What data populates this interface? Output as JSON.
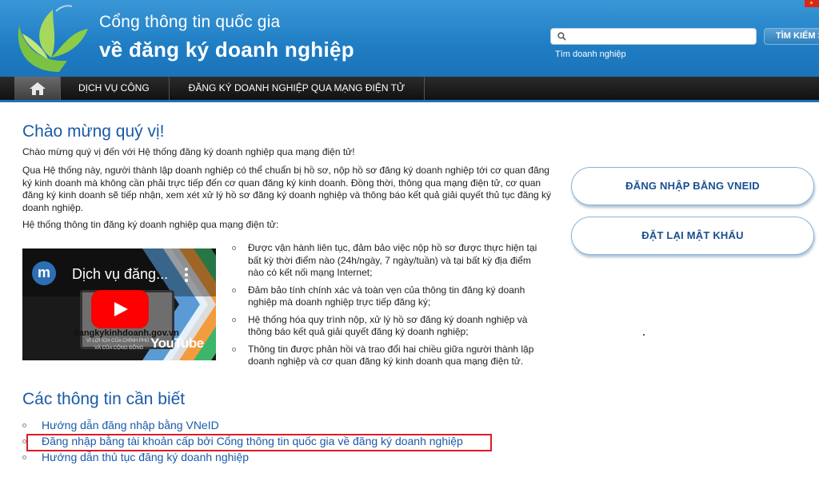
{
  "header": {
    "title_line1": "Cổng thông tin quốc gia",
    "title_line2": "về đăng ký doanh nghiệp",
    "search": {
      "value": "",
      "hint": "Tìm doanh nghiệp",
      "button_label": "TÌM KIẾM >"
    },
    "flag_icon": "vietnam-flag-icon",
    "logo_icon": "leaf-logo-icon"
  },
  "nav": {
    "home_icon": "home-icon",
    "items": [
      {
        "label": "DỊCH VỤ CÔNG"
      },
      {
        "label": "ĐĂNG KÝ DOANH NGHIỆP QUA MẠNG ĐIỆN TỬ"
      }
    ]
  },
  "main": {
    "welcome_title": "Chào mừng quý vị!",
    "p1": "Chào mừng quý vị đến với Hệ thống đăng ký doanh nghiệp qua mạng điện tử!",
    "p2": "Qua Hệ thống này, người thành lập doanh nghiệp có thể chuẩn bị hồ sơ, nộp hồ sơ đăng ký doanh nghiệp tới cơ quan đăng ký kinh doanh mà không cần phải trực tiếp đến cơ quan đăng ký kinh doanh. Đồng thời, thông qua mạng điện tử, cơ quan đăng ký kinh doanh sẽ tiếp nhận, xem xét xử lý hồ sơ đăng ký doanh nghiệp và thông báo kết quả giải quyết thủ tục đăng ký doanh nghiệp.",
    "p3": "Hệ thống thông tin đăng ký doanh nghiệp qua mạng điện tử:",
    "video": {
      "avatar_letter": "m",
      "title": "Dịch vụ đăng...",
      "site_text": "dangkykinhdoanh.gov.vn",
      "caption1": "VÌ LỢI ÍCH CỦA CHÍNH PHỦ",
      "caption2": "VÀ CỦA CỘNG ĐỒNG",
      "youtube_label": "YouTube"
    },
    "bullets": [
      "Được vận hành liên tục, đảm bảo việc nộp hồ sơ được thực hiện tại bất kỳ thời điểm nào (24h/ngày, 7 ngày/tuần) và tại bất kỳ địa điểm nào có kết nối mạng Internet;",
      "Đảm bảo tính chính xác và toàn vẹn của thông tin đăng ký doanh nghiệp mà doanh nghiệp trực tiếp đăng ký;",
      "Hệ thống hóa quy trình nộp, xử lý hồ sơ đăng ký doanh nghiệp và thông báo kết quả giải quyết đăng ký doanh nghiệp;",
      "Thông tin được phản hồi và trao đổi hai chiều giữa người thành lập doanh nghiệp và cơ quan đăng ký kinh doanh qua mạng điện tử."
    ],
    "info_title": "Các thông tin cần biết",
    "links": [
      "Hướng dẫn đăng nhập bằng VNeID",
      "Đăng nhập bằng tài khoản cấp bởi Cổng thông tin quốc gia về đăng ký doanh nghiệp",
      "Hướng dẫn thủ tục đăng ký doanh nghiệp"
    ]
  },
  "sidebar": {
    "login_vneid_label": "ĐĂNG NHẬP BẰNG VNEID",
    "reset_password_label": "ĐẶT LẠI MẬT KHẨU"
  },
  "colors": {
    "header_blue": "#1f7dc4",
    "link_blue": "#1a5aa8",
    "highlight_red": "#e01b24",
    "nav_dark": "#111111"
  }
}
